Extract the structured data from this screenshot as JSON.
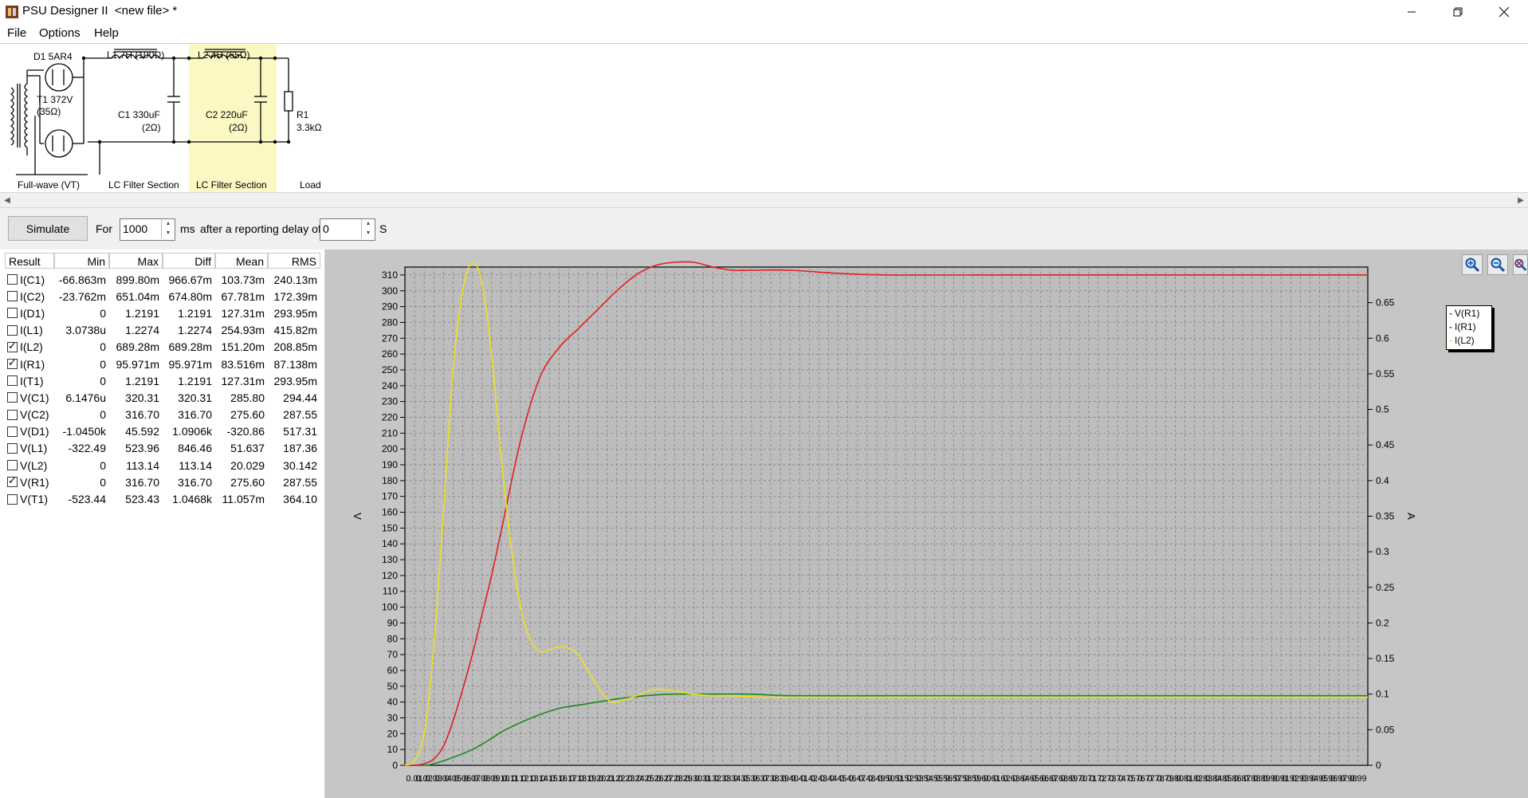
{
  "window": {
    "app_name": "PSU Designer II",
    "file_label": "<new file> *",
    "icon": "app-icon",
    "controls": [
      "minimize-icon",
      "restore-icon",
      "close-icon"
    ]
  },
  "menu": [
    "File",
    "Options",
    "Help"
  ],
  "schematic": {
    "labels": {
      "d1": "D1 5AR4",
      "l1": "L1 7H (100Ω)",
      "l2": "L2 4H (65Ω)",
      "t1_a": "T1 372V",
      "t1_b": "(35Ω)",
      "c1_a": "C1 330uF",
      "c1_b": "(2Ω)",
      "c2_a": "C2 220uF",
      "c2_b": "(2Ω)",
      "r1_a": "R1",
      "r1_b": "3.3kΩ"
    },
    "sections": [
      "Full-wave (VT)",
      "LC Filter Section",
      "LC Filter Section",
      "Load"
    ],
    "highlight_color": "#fcf8c4"
  },
  "simulation": {
    "button_label": "Simulate",
    "for_label": "For",
    "duration_value": "1000",
    "ms_label": "ms",
    "delay_label": "after a reporting delay of",
    "delay_value": "0",
    "s_label": "S"
  },
  "results": {
    "columns": [
      "Result",
      "Min",
      "Max",
      "Diff",
      "Mean",
      "RMS"
    ],
    "rows": [
      {
        "checked": false,
        "name": "I(C1)",
        "min": "-66.863m",
        "max": "899.80m",
        "diff": "966.67m",
        "mean": "103.73m",
        "rms": "240.13m"
      },
      {
        "checked": false,
        "name": "I(C2)",
        "min": "-23.762m",
        "max": "651.04m",
        "diff": "674.80m",
        "mean": "67.781m",
        "rms": "172.39m"
      },
      {
        "checked": false,
        "name": "I(D1)",
        "min": "0",
        "max": "1.2191",
        "diff": "1.2191",
        "mean": "127.31m",
        "rms": "293.95m"
      },
      {
        "checked": false,
        "name": "I(L1)",
        "min": "3.0738u",
        "max": "1.2274",
        "diff": "1.2274",
        "mean": "254.93m",
        "rms": "415.82m"
      },
      {
        "checked": true,
        "name": "I(L2)",
        "min": "0",
        "max": "689.28m",
        "diff": "689.28m",
        "mean": "151.20m",
        "rms": "208.85m"
      },
      {
        "checked": true,
        "name": "I(R1)",
        "min": "0",
        "max": "95.971m",
        "diff": "95.971m",
        "mean": "83.516m",
        "rms": "87.138m"
      },
      {
        "checked": false,
        "name": "I(T1)",
        "min": "0",
        "max": "1.2191",
        "diff": "1.2191",
        "mean": "127.31m",
        "rms": "293.95m"
      },
      {
        "checked": false,
        "name": "V(C1)",
        "min": "6.1476u",
        "max": "320.31",
        "diff": "320.31",
        "mean": "285.80",
        "rms": "294.44"
      },
      {
        "checked": false,
        "name": "V(C2)",
        "min": "0",
        "max": "316.70",
        "diff": "316.70",
        "mean": "275.60",
        "rms": "287.55"
      },
      {
        "checked": false,
        "name": "V(D1)",
        "min": "-1.0450k",
        "max": "45.592",
        "diff": "1.0906k",
        "mean": "-320.86",
        "rms": "517.31"
      },
      {
        "checked": false,
        "name": "V(L1)",
        "min": "-322.49",
        "max": "523.96",
        "diff": "846.46",
        "mean": "51.637",
        "rms": "187.36"
      },
      {
        "checked": false,
        "name": "V(L2)",
        "min": "0",
        "max": "113.14",
        "diff": "113.14",
        "mean": "20.029",
        "rms": "30.142"
      },
      {
        "checked": true,
        "name": "V(R1)",
        "min": "0",
        "max": "316.70",
        "diff": "316.70",
        "mean": "275.60",
        "rms": "287.55"
      },
      {
        "checked": false,
        "name": "V(T1)",
        "min": "-523.44",
        "max": "523.43",
        "diff": "1.0468k",
        "mean": "11.057m",
        "rms": "364.10"
      }
    ]
  },
  "zoom_buttons": [
    "zoom-in-icon",
    "zoom-out-icon",
    "zoom-reset-icon"
  ],
  "chart_data": {
    "type": "line",
    "grid": true,
    "background": "#c6c6c6",
    "plot_background": "#bdbdbd",
    "legend_position": "top-right",
    "ylabel_left": "V",
    "ylabel_right": "A",
    "ylim_left": [
      0,
      315
    ],
    "ylim_right": [
      0,
      0.7
    ],
    "yticks_left": [
      0,
      10,
      20,
      30,
      40,
      50,
      60,
      70,
      80,
      90,
      100,
      110,
      120,
      130,
      140,
      150,
      160,
      170,
      180,
      190,
      200,
      210,
      220,
      230,
      240,
      250,
      260,
      270,
      280,
      290,
      300,
      310
    ],
    "yticks_right": [
      0,
      0.05,
      0.1,
      0.15,
      0.2,
      0.25,
      0.3,
      0.35,
      0.4,
      0.45,
      0.5,
      0.55,
      0.6,
      0.65
    ],
    "yticks_right_labels": [
      "0",
      "0.05",
      "0.1",
      "0.15",
      "0.2",
      "0.25",
      "0.3",
      "0.35",
      "0.4",
      "0.45",
      "0.5",
      "0.55",
      "0.6",
      "0.65"
    ],
    "xlim": [
      0,
      1
    ],
    "xtick_step": 0.01,
    "series": [
      {
        "name": "V(R1)",
        "axis": "left",
        "color": "#e02020",
        "x": [
          0,
          0.01,
          0.02,
          0.03,
          0.04,
          0.05,
          0.06,
          0.07,
          0.08,
          0.09,
          0.1,
          0.12,
          0.14,
          0.16,
          0.18,
          0.2,
          0.22,
          0.24,
          0.26,
          0.28,
          0.3,
          0.32,
          0.34,
          0.36,
          0.4,
          0.45,
          0.5,
          0.6,
          0.7,
          0.8,
          0.9,
          1.0
        ],
        "y": [
          0,
          0,
          1,
          4,
          12,
          28,
          48,
          70,
          95,
          120,
          148,
          205,
          245,
          264,
          276,
          288,
          300,
          310,
          316,
          318,
          318,
          315,
          313,
          313,
          313,
          311,
          310,
          310,
          310,
          310,
          310,
          310
        ]
      },
      {
        "name": "I(R1)",
        "axis": "left",
        "color": "#1a8a1a",
        "x": [
          0,
          0.02,
          0.03,
          0.05,
          0.07,
          0.09,
          0.1,
          0.12,
          0.14,
          0.16,
          0.18,
          0.2,
          0.22,
          0.25,
          0.28,
          0.32,
          0.36,
          0.4,
          0.5,
          0.6,
          0.7,
          0.8,
          0.9,
          1.0
        ],
        "y": [
          0,
          0,
          1,
          5,
          10,
          17,
          21,
          27,
          32,
          36,
          38,
          40,
          42,
          44,
          45,
          45,
          45,
          44,
          44,
          44,
          44,
          44,
          44,
          44
        ]
      },
      {
        "name": "I(L2)",
        "axis": "left",
        "color": "#f0e020",
        "x": [
          0,
          0.01,
          0.02,
          0.03,
          0.04,
          0.05,
          0.06,
          0.07,
          0.08,
          0.09,
          0.1,
          0.11,
          0.12,
          0.13,
          0.14,
          0.15,
          0.16,
          0.17,
          0.18,
          0.19,
          0.2,
          0.21,
          0.22,
          0.24,
          0.26,
          0.28,
          0.3,
          0.32,
          0.34,
          0.37,
          0.4,
          0.43,
          0.46,
          0.5,
          0.55,
          0.6,
          0.7,
          0.8,
          0.9,
          1.0
        ],
        "y": [
          0,
          3,
          20,
          75,
          160,
          250,
          300,
          318,
          305,
          260,
          195,
          140,
          100,
          80,
          72,
          73,
          75,
          74,
          70,
          60,
          50,
          42,
          40,
          44,
          48,
          47,
          45,
          44,
          44,
          43,
          43,
          43,
          43,
          43,
          43,
          43,
          43,
          43,
          43,
          43
        ]
      }
    ]
  }
}
